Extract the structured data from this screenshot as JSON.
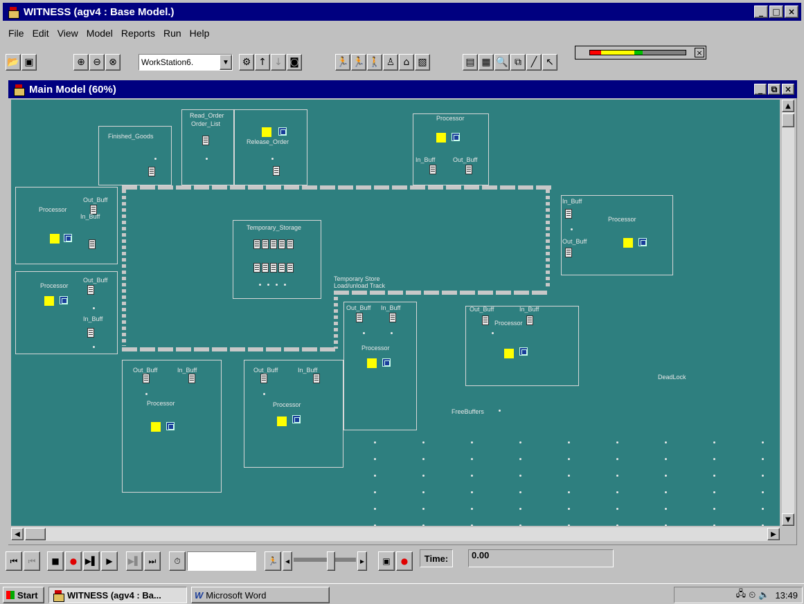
{
  "window": {
    "title": "WITNESS (agv4 : Base Model.)",
    "min": "_",
    "max": "□",
    "close": "×"
  },
  "menu": [
    "File",
    "Edit",
    "View",
    "Model",
    "Reports",
    "Run",
    "Help"
  ],
  "toolbar": {
    "element_combo": "WorkStation6.",
    "combo_arrow": "▼",
    "buttons": [
      "open-icon",
      "save-icon",
      "zoom-in-icon",
      "zoom-out-icon",
      "target-icon",
      "display-icon",
      "up-icon",
      "down-icon",
      "camera-icon",
      "run-man-icon",
      "run-man2-icon",
      "walk-icon",
      "chair-icon",
      "house-icon",
      "paint-icon",
      "report-icon",
      "report2-icon",
      "preview-icon",
      "copy-icon",
      "line-icon",
      "pointer-icon"
    ],
    "floating_close": "×",
    "meter_colors": [
      "#ff0000",
      "#ffff00",
      "#ffff00",
      "#ffff00",
      "#00c000"
    ]
  },
  "child_window": {
    "title": "Main Model (60%)",
    "min": "_",
    "max": "⧉",
    "close": "×"
  },
  "model": {
    "finished_goods": "Finished_Goods",
    "read_order": "Read_Order",
    "order_list": "Order_List",
    "release_order": "Release_Order",
    "processor": "Processor",
    "out_buff": "Out_Buff",
    "in_buff": "In_Buff",
    "temporary_storage": "Temporary_Storage",
    "temp_store_track_1": "Temporary Store",
    "temp_store_track_2": "Load/unload Track",
    "free_buffers": "FreeBuffers",
    "dead_lock": "DeadLock"
  },
  "playback": {
    "time_label": "Time:",
    "time_value": "0.00",
    "step_value": ""
  },
  "taskbar": {
    "start": "Start",
    "task1": "WITNESS (agv4 : Ba...",
    "task2": "Microsoft Word",
    "clock": "13:49"
  }
}
